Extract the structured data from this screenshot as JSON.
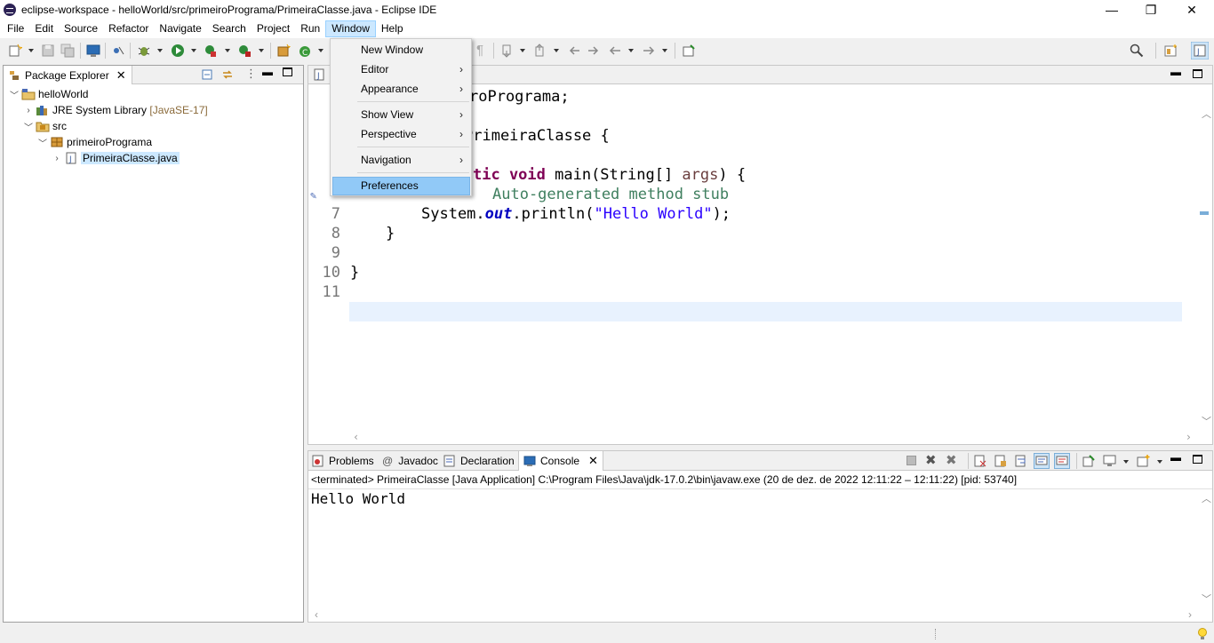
{
  "window": {
    "title": "eclipse-workspace - helloWorld/src/primeiroPrograma/PrimeiraClasse.java - Eclipse IDE",
    "minimize": "—",
    "maximize": "❐",
    "close": "✕"
  },
  "menubar": [
    "File",
    "Edit",
    "Source",
    "Refactor",
    "Navigate",
    "Search",
    "Project",
    "Run",
    "Window",
    "Help"
  ],
  "window_menu": {
    "items": [
      {
        "label": "New Window",
        "submenu": false
      },
      {
        "label": "Editor",
        "submenu": true
      },
      {
        "label": "Appearance",
        "submenu": true
      },
      {
        "label": "Show View",
        "submenu": true
      },
      {
        "label": "Perspective",
        "submenu": true
      },
      {
        "label": "Navigation",
        "submenu": true
      },
      {
        "label": "Preferences",
        "submenu": false,
        "selected": true
      }
    ]
  },
  "package_explorer": {
    "tab_label": "Package Explorer",
    "tree": [
      {
        "label": "helloWorld",
        "level": 0,
        "expanded": true,
        "icon": "project-icon"
      },
      {
        "label": "JRE System Library",
        "suffix": "[JavaSE-17]",
        "level": 1,
        "expanded": false,
        "icon": "library-icon"
      },
      {
        "label": "src",
        "level": 1,
        "expanded": true,
        "icon": "source-folder-icon"
      },
      {
        "label": "primeiroPrograma",
        "level": 2,
        "expanded": true,
        "icon": "package-icon"
      },
      {
        "label": "PrimeiraClasse.java",
        "level": 3,
        "expanded": false,
        "icon": "java-file-icon",
        "selected": true
      }
    ]
  },
  "editor": {
    "lines": [
      {
        "num": "",
        "text": "roPrograma;"
      },
      {
        "num": "",
        "text": "PrimeiraClasse {"
      },
      {
        "num": "",
        "text": "tic void main(String[] args) {"
      },
      {
        "num": "",
        "text": "Auto-generated method stub"
      },
      {
        "num": "7",
        "text": "System.out.println(\"Hello World\");"
      },
      {
        "num": "8",
        "text": "}"
      },
      {
        "num": "9",
        "text": ""
      },
      {
        "num": "10",
        "text": "}"
      },
      {
        "num": "11",
        "text": ""
      }
    ]
  },
  "console": {
    "tabs": [
      "Problems",
      "Javadoc",
      "Declaration",
      "Console"
    ],
    "status": "<terminated> PrimeiraClasse [Java Application] C:\\Program Files\\Java\\jdk-17.0.2\\bin\\javaw.exe  (20 de dez. de 2022 12:11:22 – 12:11:22) [pid: 53740]",
    "output": "Hello World"
  },
  "colors": {
    "keyword": "#7f0055",
    "string": "#2a00ff",
    "comment": "#3f7f5f",
    "field": "#0000c0",
    "selection": "#91c9f7"
  }
}
